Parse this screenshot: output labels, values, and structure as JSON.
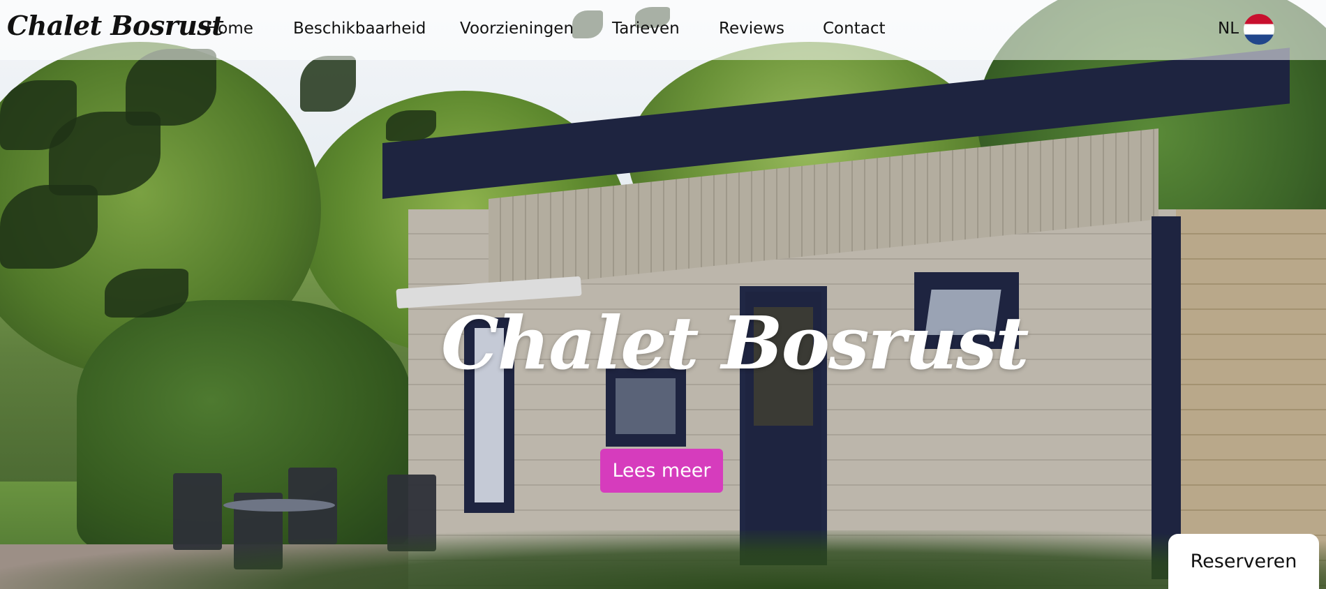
{
  "site": {
    "logo": "Chalet Bosrust"
  },
  "nav": {
    "items": [
      {
        "label": "Home"
      },
      {
        "label": "Beschikbaarheid"
      },
      {
        "label": "Voorzieningen"
      },
      {
        "label": "Tarieven"
      },
      {
        "label": "Reviews"
      },
      {
        "label": "Contact"
      }
    ],
    "language": "NL",
    "flag_icon": "netherlands-flag-icon"
  },
  "hero": {
    "title": "Chalet Bosrust",
    "cta_label": "Lees meer",
    "image_description": "chalet-with-garden-photo"
  },
  "reserve": {
    "label": "Reserveren"
  },
  "colors": {
    "cta": "#d63cbd",
    "header_bg": "rgba(255,255,255,0.55)"
  }
}
